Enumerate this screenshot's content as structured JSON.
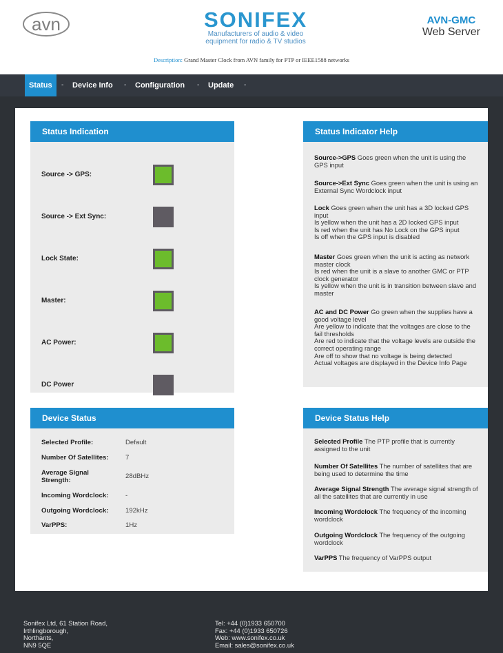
{
  "header": {
    "logo_text": "avn",
    "brand_name": "SONIFEX",
    "brand_tagline_1": "Manufacturers of audio & video",
    "brand_tagline_2": "equipment for radio & TV studios",
    "product_model": "AVN-GMC",
    "product_subtitle": "Web Server",
    "description_label": "Description:",
    "description_text": "Grand Master Clock from AVN family for PTP or IEEE1588 networks"
  },
  "nav": {
    "items": [
      {
        "label": "Status",
        "active": true
      },
      {
        "label": "Device Info",
        "active": false
      },
      {
        "label": "Configuration",
        "active": false
      },
      {
        "label": "Update",
        "active": false
      }
    ],
    "separator": "-"
  },
  "status_indication": {
    "title": "Status Indication",
    "rows": [
      {
        "label": "Source -> GPS:",
        "state": "green"
      },
      {
        "label": "Source -> Ext Sync:",
        "state": "off"
      },
      {
        "label": "Lock State:",
        "state": "green"
      },
      {
        "label": "Master:",
        "state": "green"
      },
      {
        "label": "AC Power:",
        "state": "green"
      },
      {
        "label": "DC Power",
        "state": "off"
      }
    ]
  },
  "status_help": {
    "title": "Status Indicator Help",
    "entries": [
      {
        "term": "Source->GPS",
        "text": " Goes green when the unit is using the GPS input"
      },
      {
        "term": "Source->Ext Sync",
        "text": " Goes green when the unit is using an External Sync Wordclock input"
      },
      {
        "term": "Lock",
        "text": " Goes green when the unit has a 3D locked GPS input\nIs yellow when the unit has a 2D locked GPS input\nIs red when the unit has No Lock on the GPS input\nIs off when the GPS input is disabled"
      },
      {
        "term": "Master",
        "text": " Goes green when the unit is acting as network master clock\nIs red when the unit is a slave to another GMC or PTP clock generator\nIs yellow when the unit is in transition between slave and master"
      },
      {
        "term": "AC and DC Power",
        "text": " Go green when the supplies have a good voltage level\nAre yellow to indicate that the voltages are close to the fail thresholds\nAre red to indicate that the voltage levels are outside the correct operating range\nAre off to show that no voltage is being detected\nActual voltages are displayed in the Device Info Page"
      }
    ]
  },
  "device_status": {
    "title": "Device Status",
    "rows": [
      {
        "label": "Selected Profile:",
        "value": "Default"
      },
      {
        "label": "Number Of Satellites:",
        "value": "7"
      },
      {
        "label": "Average Signal Strength:",
        "value": "28dBHz"
      },
      {
        "label": "Incoming Wordclock:",
        "value": "-"
      },
      {
        "label": "Outgoing Wordclock:",
        "value": "192kHz"
      },
      {
        "label": "VarPPS:",
        "value": "1Hz"
      }
    ]
  },
  "device_help": {
    "title": "Device Status Help",
    "entries": [
      {
        "term": "Selected Profile",
        "text": " The PTP profile that is currently assigned to the unit"
      },
      {
        "term": "Number Of Satellites",
        "text": " The number of satellites that are being used to determine the time"
      },
      {
        "term": "Average Signal Strength",
        "text": " The average signal strength of all the satellites that are currently in use"
      },
      {
        "term": "Incoming Wordclock",
        "text": " The frequency of the incoming wordclock"
      },
      {
        "term": "Outgoing Wordclock",
        "text": " The frequency of the outgoing wordclock"
      },
      {
        "term": "VarPPS",
        "text": " The frequency of VarPPS output"
      }
    ]
  },
  "footer": {
    "address": [
      "Sonifex Ltd, 61 Station Road,",
      "Irthlingborough,",
      "Northants,",
      "NN9 5QE"
    ],
    "contact": [
      "Tel: +44 (0)1933 650700",
      "Fax: +44 (0)1933 650726",
      "Web: www.sonifex.co.uk",
      "Email: sales@sonifex.co.uk"
    ]
  },
  "colors": {
    "accent": "#1f8fcf",
    "nav_bg": "#333840",
    "led_green": "#6cbc2c",
    "led_off": "#5f5b62",
    "panel_bg": "#ebebeb"
  }
}
